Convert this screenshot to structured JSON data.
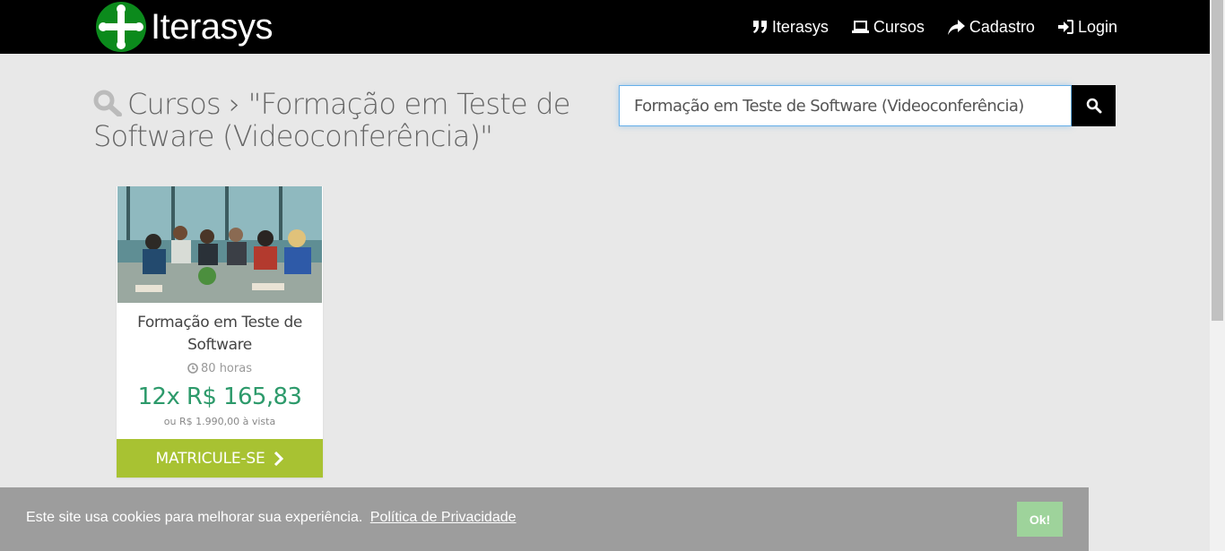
{
  "navbar": {
    "brand": "Iterasys",
    "links": [
      {
        "label": "Iterasys",
        "icon": "quote-icon"
      },
      {
        "label": "Cursos",
        "icon": "laptop-icon"
      },
      {
        "label": "Cadastro",
        "icon": "share-arrow-icon"
      },
      {
        "label": "Login",
        "icon": "sign-in-icon"
      }
    ]
  },
  "page": {
    "heading": "Cursos › \"Formação em Teste de Software (Videoconferência)\""
  },
  "search": {
    "value": "Formação em Teste de Software (Videoconferência)"
  },
  "course": {
    "title": "Formação em Teste de Software",
    "hours": "80 horas",
    "installment": "12x R$ 165,83",
    "full_price": "ou R$ 1.990,00 à vista",
    "cta": "MATRICULE-SE"
  },
  "cookie": {
    "text": "Este site usa cookies para melhorar sua experiência.",
    "link": "Política de Privacidade",
    "ok": "Ok!"
  },
  "colors": {
    "navbar": "#000000",
    "brand_green": "#0b8a1c",
    "price_green": "#2d9a6b",
    "cta_green": "#a8c232",
    "cookie_bg": "#9d9d9d",
    "ok_bg": "#9ed39b"
  }
}
